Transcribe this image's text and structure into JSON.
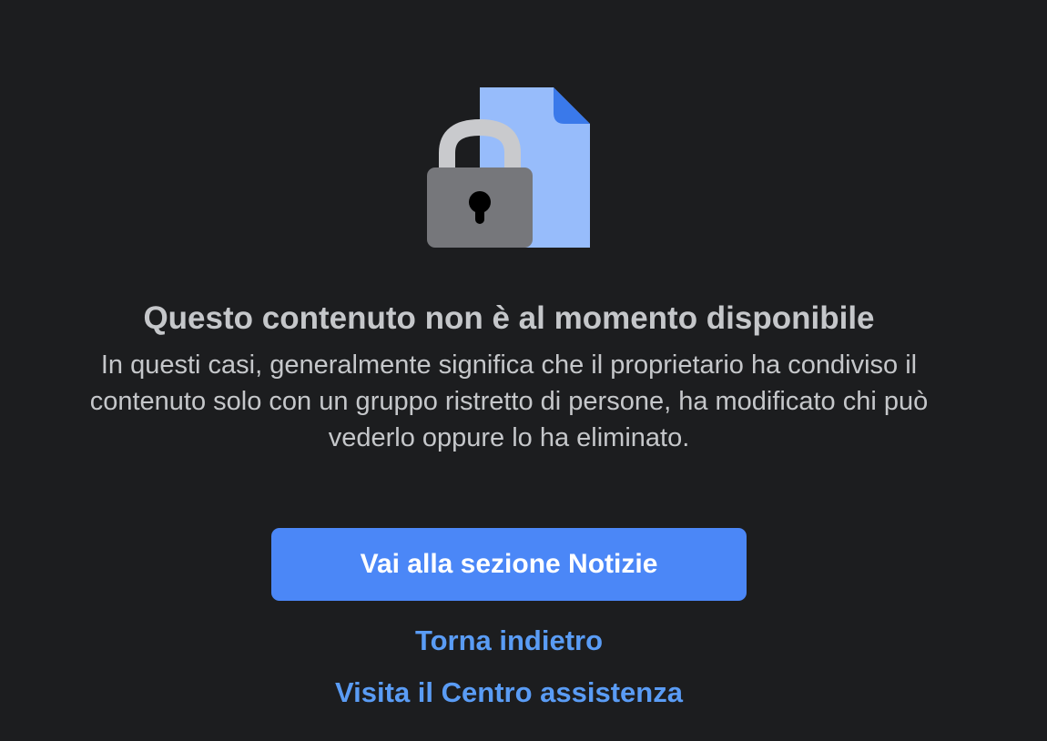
{
  "illustration": {
    "icon": "locked-document-icon",
    "colors": {
      "document": "#97bcfb",
      "document_fold": "#3a79ea",
      "lock_body": "#76777b",
      "lock_shackle": "#c9cacd",
      "keyhole": "#000000"
    }
  },
  "message": {
    "title": "Questo contenuto non è al momento disponibile",
    "description": "In questi casi, generalmente significa che il proprietario ha condiviso il contenuto solo con un gruppo ristretto di persone, ha modificato chi può vederlo oppure lo ha eliminato."
  },
  "actions": {
    "primary_label": "Vai alla sezione Notizie",
    "back_label": "Torna indietro",
    "help_label": "Visita il Centro assistenza"
  },
  "theme": {
    "background": "#1c1d1f",
    "text": "#c5c7ca",
    "primary_button": "#4b87f7",
    "link": "#5a9cf5"
  }
}
